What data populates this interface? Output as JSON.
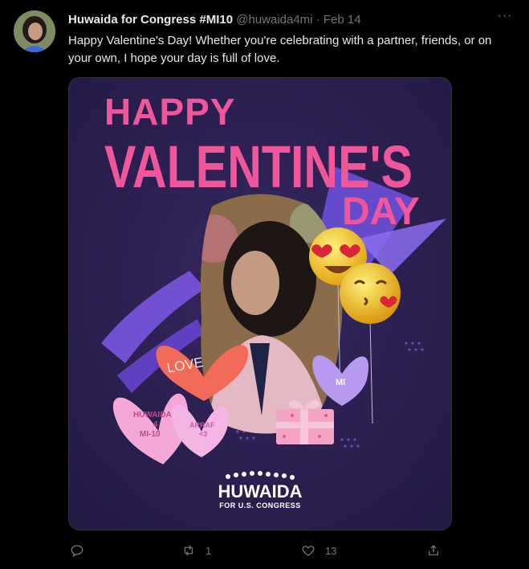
{
  "tweet": {
    "author_name": "Huwaida for Congress #MI10",
    "handle": "@huwaida4mi",
    "separator": "·",
    "date": "Feb 14",
    "more_label": "···",
    "text": "Happy Valentine's Day! Whether you're celebrating with a partner, friends, or on your own, I hope your day is full of love."
  },
  "media": {
    "headline_line1": "HAPPY",
    "headline_line2": "VALENTINE'S",
    "headline_line3": "DAY",
    "heart_love": "LOVE",
    "heart_huwaida_1": "HUWAIDA",
    "heart_huwaida_2": "4",
    "heart_huwaida_3": "MI-10",
    "heart_arraf_1": "ARRAF",
    "heart_arraf_2": "<3",
    "heart_mi": "MI",
    "logo_name": "HUWAIDA",
    "logo_sub": "FOR U.S. CONGRESS"
  },
  "actions": {
    "reply_count": "",
    "retweet_count": "1",
    "like_count": "13"
  },
  "colors": {
    "background": "#000000",
    "card_bg": "#2b2150",
    "headline_pink": "#f0579b",
    "accent_purple": "#7b55e0",
    "text_primary": "#e7e9ea",
    "text_secondary": "#71767b"
  },
  "icons": [
    "reply-icon",
    "retweet-icon",
    "like-icon",
    "share-icon",
    "more-icon"
  ]
}
